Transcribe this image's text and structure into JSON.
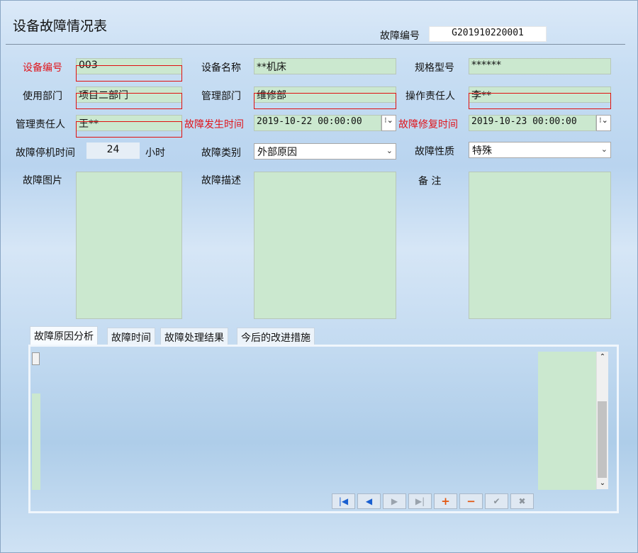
{
  "form": {
    "title": "设备故障情况表",
    "fault_no_label": "故障编号",
    "fault_no_value": "G201910220001"
  },
  "fields": {
    "equip_no_label": "设备编号",
    "equip_no_value": "003",
    "equip_name_label": "设备名称",
    "equip_name_value": "**机床",
    "model_label": "规格型号",
    "model_value": "******",
    "use_dept_label": "使用部门",
    "use_dept_value": "项目二部门",
    "mgmt_dept_label": "管理部门",
    "mgmt_dept_value": "维修部",
    "operator_label": "操作责任人",
    "operator_value": "李**",
    "manager_label": "管理责任人",
    "manager_value": "王**",
    "occur_time_label": "故障发生时间",
    "occur_time_value": "2019-10-22 00:00:00",
    "repair_time_label": "故障修复时间",
    "repair_time_value": "2019-10-23 00:00:00",
    "downtime_label": "故障停机时间",
    "downtime_value": "24",
    "downtime_unit": "小时",
    "fault_type_label": "故障类别",
    "fault_type_value": "外部原因",
    "fault_nature_label": "故障性质",
    "fault_nature_value": "特殊",
    "picture_label": "故障图片",
    "desc_label": "故障描述",
    "remark_label": "备 注"
  },
  "tabs": [
    {
      "label": "故障原因分析",
      "active": true
    },
    {
      "label": "故障时间",
      "active": false
    },
    {
      "label": "故障处理结果",
      "active": false
    },
    {
      "label": "今后的改进措施",
      "active": false
    }
  ],
  "nav": {
    "first": "|◀",
    "prev": "◀",
    "next": "▶",
    "last": "▶|",
    "add": "+",
    "delete": "−",
    "save": "✔",
    "cancel": "✖"
  },
  "icons": {
    "dropdown": "chevron-down-icon",
    "spin": "spin-icon"
  },
  "colors": {
    "required_label": "#e0141b",
    "field_bg": "#cbe8cf",
    "highlight_border": "#e01010"
  }
}
